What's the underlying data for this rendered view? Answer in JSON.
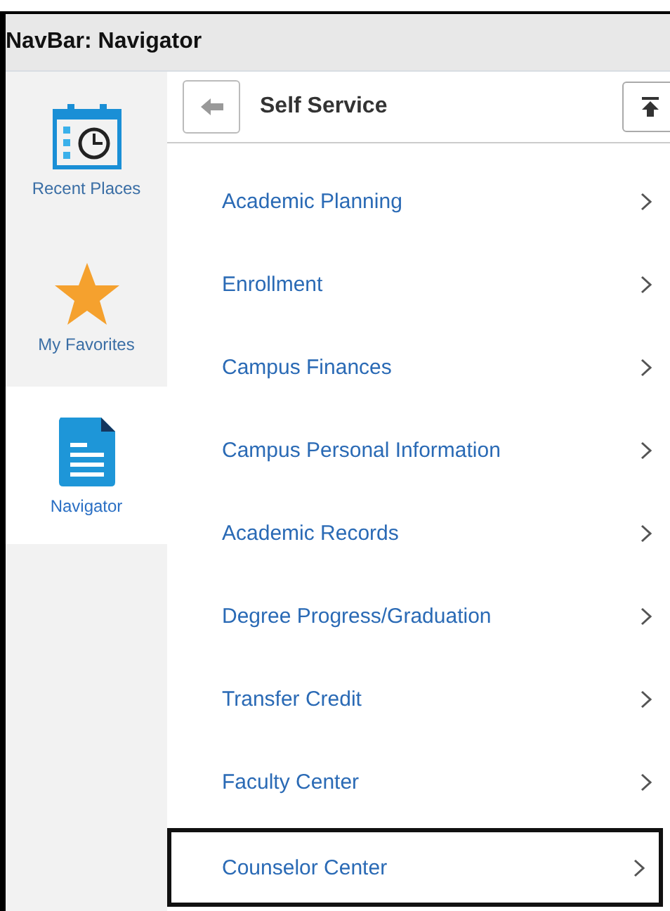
{
  "window": {
    "title": "NavBar: Navigator"
  },
  "sidebar": {
    "items": [
      {
        "label": "Recent Places",
        "kind": "recent",
        "selected": false
      },
      {
        "label": "My Favorites",
        "kind": "favorites",
        "selected": false
      },
      {
        "label": "Navigator",
        "kind": "navigator",
        "selected": true
      }
    ]
  },
  "header": {
    "title": "Self Service"
  },
  "menu": {
    "items": [
      {
        "label": "Academic Planning",
        "highlighted": false
      },
      {
        "label": "Enrollment",
        "highlighted": false
      },
      {
        "label": "Campus Finances",
        "highlighted": false
      },
      {
        "label": "Campus Personal Information",
        "highlighted": false
      },
      {
        "label": "Academic Records",
        "highlighted": false
      },
      {
        "label": "Degree Progress/Graduation",
        "highlighted": false
      },
      {
        "label": "Transfer Credit",
        "highlighted": false
      },
      {
        "label": "Faculty Center",
        "highlighted": false
      },
      {
        "label": "Counselor Center",
        "highlighted": true
      }
    ]
  }
}
